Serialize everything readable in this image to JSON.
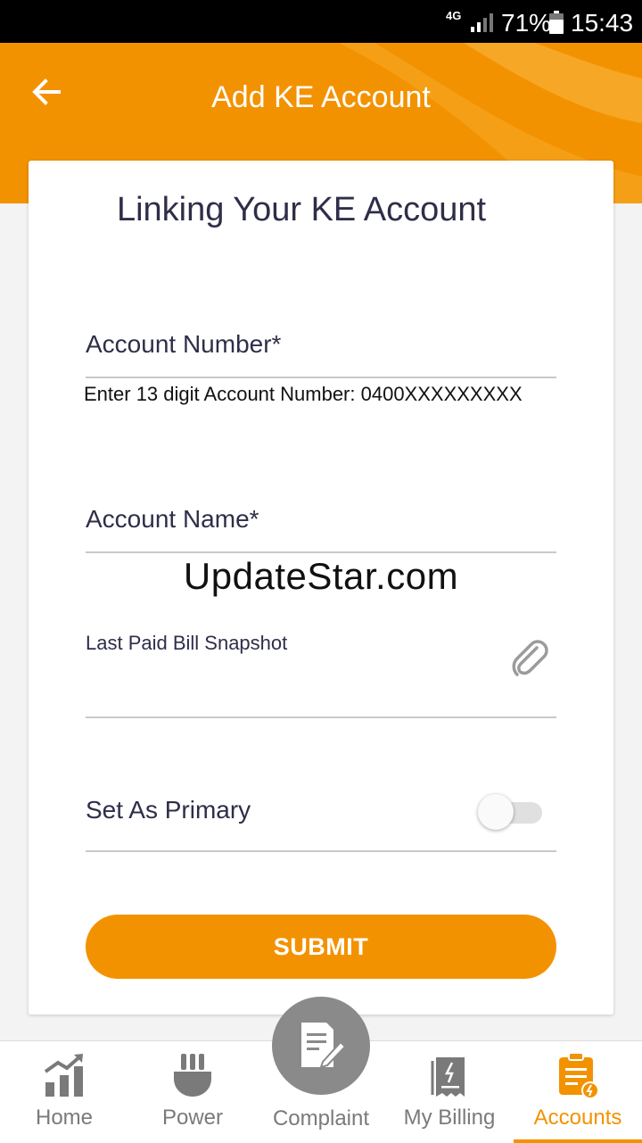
{
  "status_bar": {
    "network": "4G",
    "battery_percent": "71%",
    "time": "15:43"
  },
  "header": {
    "title": "Add KE Account"
  },
  "form": {
    "heading": "Linking Your KE Account",
    "account_number": {
      "label": "Account Number*",
      "value": "",
      "hint": "Enter 13 digit Account Number: 0400XXXXXXXXX"
    },
    "account_name": {
      "label": "Account Name*",
      "value": ""
    },
    "watermark": "UpdateStar.com",
    "bill_snapshot": {
      "label": "Last Paid Bill Snapshot"
    },
    "set_primary": {
      "label": "Set As Primary",
      "on": false
    },
    "submit_label": "SUBMIT"
  },
  "bottom_nav": {
    "items": [
      {
        "label": "Home",
        "icon": "bar-chart-icon"
      },
      {
        "label": "Power",
        "icon": "plug-icon"
      },
      {
        "label": "Complaint",
        "icon": "edit-document-icon"
      },
      {
        "label": "My Billing",
        "icon": "receipt-icon"
      },
      {
        "label": "Accounts",
        "icon": "clipboard-icon",
        "active": true
      }
    ]
  },
  "colors": {
    "accent": "#f39200",
    "inactive_nav": "#7a7a7a",
    "text": "#2e2e4a"
  }
}
